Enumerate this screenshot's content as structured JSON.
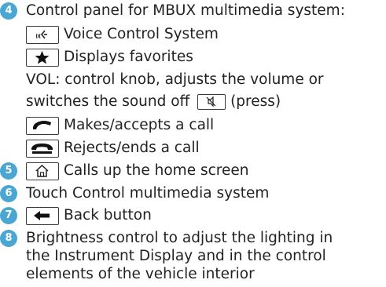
{
  "colors": {
    "badge": "#4aa6d3",
    "text": "#222222",
    "key_border": "#3a3a3a"
  },
  "items": [
    {
      "number": "4",
      "text": "Control panel for MBUX multimedia system:",
      "sub": [
        {
          "icon": "voice-control-icon",
          "text": "Voice Control System"
        },
        {
          "icon": "star-icon",
          "text": "Displays favorites"
        },
        {
          "text": "VOL: control knob, adjusts the volume or"
        },
        {
          "text": "switches the sound off",
          "icon_after": "mute-icon",
          "text_after": "(press)"
        },
        {
          "icon": "phone-accept-icon",
          "text": "Makes/accepts a call"
        },
        {
          "icon": "phone-reject-icon",
          "text": "Rejects/ends a call"
        }
      ]
    },
    {
      "number": "5",
      "icon": "home-icon",
      "text": "Calls up the home screen"
    },
    {
      "number": "6",
      "text": "Touch Control multimedia system"
    },
    {
      "number": "7",
      "icon": "back-arrow-icon",
      "text": "Back button"
    },
    {
      "number": "8",
      "lines": [
        "Brightness control to adjust the lighting in",
        "the Instrument Display and in the control",
        "elements of the vehicle interior"
      ]
    }
  ]
}
